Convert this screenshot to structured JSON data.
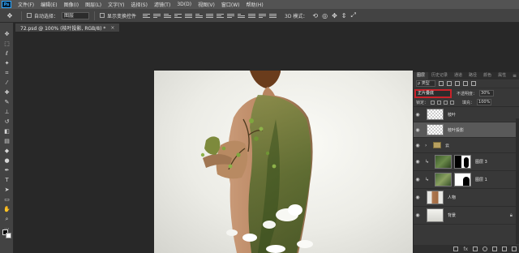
{
  "app": {
    "logo": "Ps"
  },
  "menu": [
    "文件(F)",
    "编辑(E)",
    "图像(I)",
    "图层(L)",
    "文字(Y)",
    "选择(S)",
    "滤镜(T)",
    "3D(D)",
    "视图(V)",
    "窗口(W)",
    "帮助(H)"
  ],
  "options_bar": {
    "tool_icon": "move-tool-icon",
    "auto_select_label": "自动选择：",
    "auto_select_value": "图层",
    "transform_label": "显示变换控件",
    "mode_3d_label": "3D 模式："
  },
  "document": {
    "tab_title": "72.psd @ 100% (枝叶投影, RGB/8) *",
    "close_glyph": "×"
  },
  "layers_panel": {
    "tabs": [
      "图层",
      "历史记录",
      "通道",
      "路径",
      "颜色",
      "属性"
    ],
    "active_tab": "图层",
    "filter_kind": "ρ 类型",
    "blend_mode": "正片叠底",
    "blend_highlight_color": "#c8232a",
    "opacity_label": "不透明度：",
    "opacity_value": "30%",
    "lock_label": "锁定：",
    "fill_label": "填充：",
    "fill_value": "100%",
    "layers": [
      {
        "name": "枝叶",
        "visible": true,
        "selected": false
      },
      {
        "name": "枝叶投影",
        "visible": true,
        "selected": true
      },
      {
        "name": "云",
        "visible": true,
        "selected": false
      },
      {
        "name": "图层 3",
        "visible": true,
        "selected": false
      },
      {
        "name": "图层 1",
        "visible": true,
        "selected": false
      },
      {
        "name": "人物",
        "visible": true,
        "selected": false
      },
      {
        "name": "背景",
        "visible": true,
        "selected": false
      }
    ]
  },
  "colors": {
    "foreground": "#000000",
    "background": "#ffffff"
  }
}
